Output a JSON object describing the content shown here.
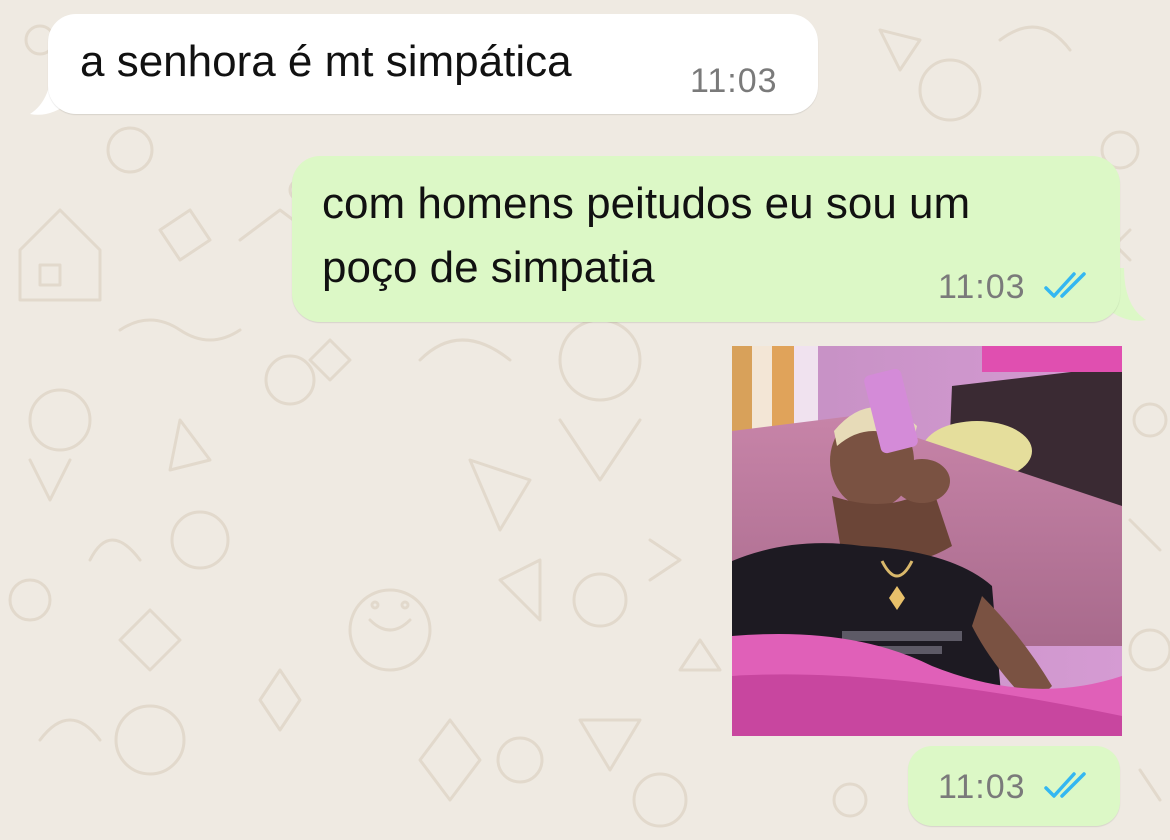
{
  "chat": {
    "messages": [
      {
        "direction": "incoming",
        "text": "a senhora é mt simpática",
        "time": "11:03"
      },
      {
        "direction": "outgoing",
        "lines": [
          "com homens peitudos eu sou um",
          "poço de simpatia"
        ],
        "time": "11:03",
        "status": "read"
      },
      {
        "direction": "outgoing",
        "type": "image",
        "time": "11:03",
        "status": "read"
      }
    ]
  },
  "colors": {
    "background": "#efeae2",
    "incoming_bubble": "#ffffff",
    "outgoing_bubble": "#dcf8c6",
    "read_ticks": "#34b7f1",
    "timestamp": "#7a7a7a"
  },
  "icons": {
    "read_status": "double-check-icon"
  }
}
